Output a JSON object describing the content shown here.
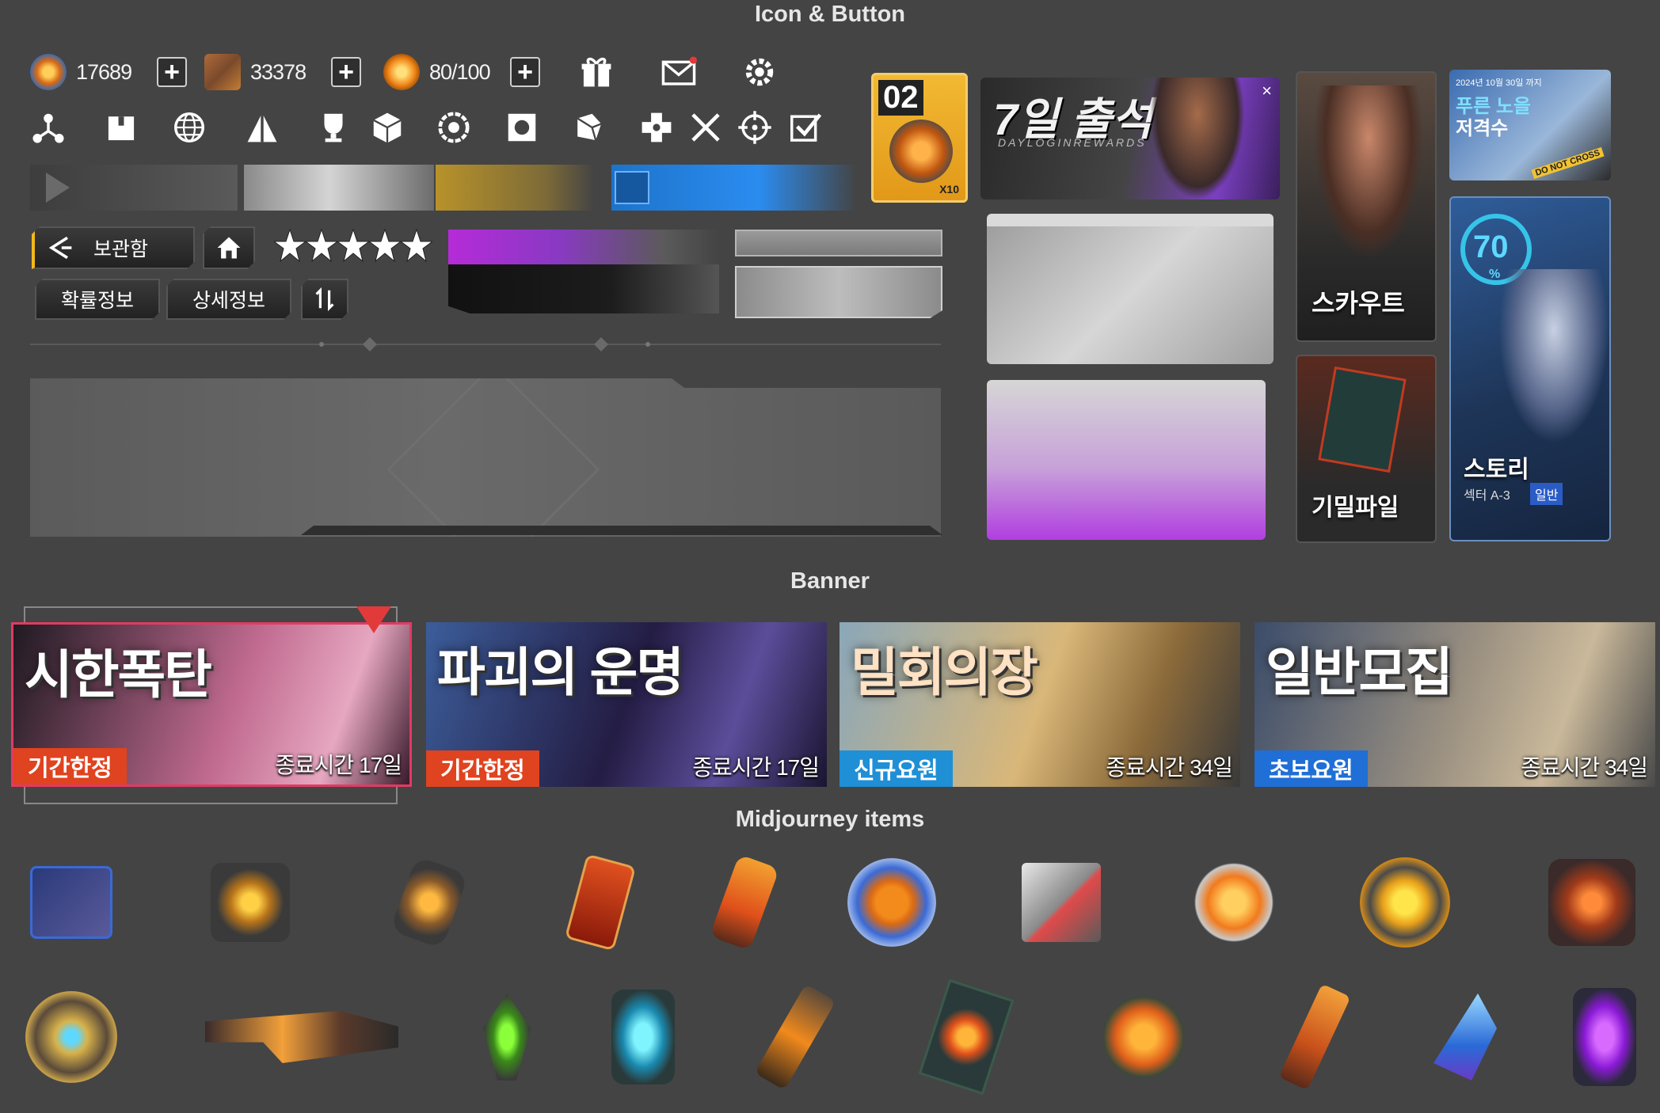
{
  "sections": {
    "icon_button": "Icon & Button",
    "banner": "Banner",
    "items": "Midjourney items"
  },
  "currencies": [
    {
      "icon": "orange-crystal-icon",
      "value": "17689"
    },
    {
      "icon": "supply-box-icon",
      "value": "33378"
    },
    {
      "icon": "energy-coin-icon",
      "value": "80/100"
    }
  ],
  "top_icons": [
    "gift-icon",
    "mail-icon",
    "settings-gear-icon"
  ],
  "icon_row": [
    "network-icon",
    "package-icon",
    "globe-icon",
    "pyramid-icon",
    "trophy-icon",
    "cube-icon",
    "flower-icon",
    "target-square-icon",
    "shield-cube-icon",
    "dpad-icon",
    "crossed-swords-icon",
    "crosshair-icon",
    "checkbox-icon"
  ],
  "buttons": {
    "storage": "보관함",
    "probability": "확률정보",
    "detail": "상세정보"
  },
  "side_cards": {
    "day_badge": "02",
    "item_count": "X10",
    "login_title": "7일 출석",
    "login_sub": "DAYLOGINREWARDS",
    "scout": "스카우트",
    "secret_file": "기밀파일",
    "story": "스토리",
    "sector": "섹터 A-3",
    "normal": "일반",
    "sniper_date": "2024년 10월 30일 까지",
    "sniper_title": "푸른 노을",
    "sniper_sub": "저격수",
    "story_percent": "70",
    "percent_sign": "%",
    "do_not_cross": "DO NOT CROSS"
  },
  "banners": [
    {
      "title": "시한폭탄",
      "badge": "기간한정",
      "time": "종료시간 17일",
      "badge_color": "#e0431f"
    },
    {
      "title": "파괴의 운명",
      "badge": "기간한정",
      "time": "종료시간 17일",
      "badge_color": "#e0431f"
    },
    {
      "title": "밀회의장",
      "badge": "신규요원",
      "time": "종료시간 34일",
      "badge_color": "#1f8fd6"
    },
    {
      "title": "일반모집",
      "badge": "초보요원",
      "time": "종료시간 34일",
      "badge_color": "#1f6fd6"
    }
  ],
  "items_row1": [
    "blue-crate-item",
    "gold-core-box-item",
    "orange-cylinder-item",
    "red-card-item",
    "fire-canister-item",
    "blue-orange-emblem-item",
    "metal-cube-item",
    "orange-emblem-item",
    "gold-reactor-item",
    "lava-cube-item"
  ],
  "items_row2": [
    "gold-hex-orb-item",
    "plasma-rifle-item",
    "green-lantern-item",
    "cyan-lantern-item",
    "orange-rod-item",
    "orange-sun-card-item",
    "energy-core-item",
    "orange-bar-item",
    "blue-crystal-item",
    "purple-lantern-item"
  ]
}
